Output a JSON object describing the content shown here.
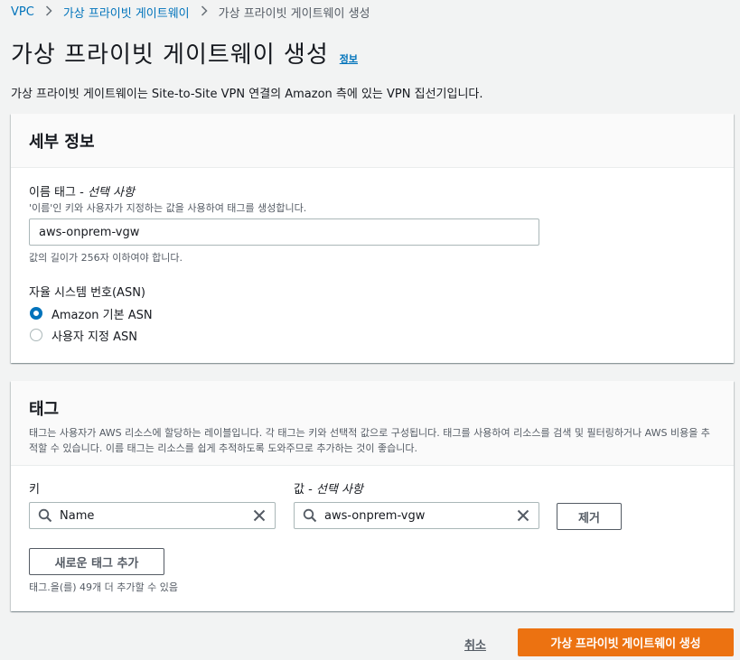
{
  "breadcrumb": {
    "items": [
      "VPC",
      "가상 프라이빗 게이트웨이",
      "가상 프라이빗 게이트웨이 생성"
    ]
  },
  "header": {
    "title": "가상 프라이빗 게이트웨이 생성",
    "info_link": "정보",
    "description": "가상 프라이빗 게이트웨이는 Site-to-Site VPN 연결의 Amazon 측에 있는 VPN 집선기입니다."
  },
  "details": {
    "title": "세부 정보",
    "name_tag": {
      "label": "이름 태그 - ",
      "optional": "선택 사항",
      "description": "'이름'인 키와 사용자가 지정하는 값을 사용하여 태그를 생성합니다.",
      "value": "aws-onprem-vgw",
      "constraint": "값의 길이가 256자 이하여야 합니다."
    },
    "asn": {
      "label": "자율 시스템 번호(ASN)",
      "options": [
        {
          "label": "Amazon 기본 ASN",
          "selected": true
        },
        {
          "label": "사용자 지정 ASN",
          "selected": false
        }
      ]
    }
  },
  "tags": {
    "title": "태그",
    "description": "태그는 사용자가 AWS 리소스에 할당하는 레이블입니다. 각 태그는 키와 선택적 값으로 구성됩니다. 태그를 사용하여 리소스를 검색 및 필터링하거나 AWS 비용을 추적할 수 있습니다. 이름 태그는 리소스를 쉽게 추적하도록 도와주므로 추가하는 것이 좋습니다.",
    "key_label": "키",
    "value_label": "값 - ",
    "value_optional": "선택 사항",
    "rows": [
      {
        "key": "Name",
        "value": "aws-onprem-vgw"
      }
    ],
    "remove_label": "제거",
    "add_label": "새로운 태그 추가",
    "remaining": "태그.을(를) 49개 더 추가할 수 있음"
  },
  "footer": {
    "cancel_label": "취소",
    "submit_label": "가상 프라이빗 게이트웨이 생성"
  },
  "colors": {
    "link": "#0073bb",
    "primary": "#ec7211",
    "background": "#f2f3f3"
  }
}
